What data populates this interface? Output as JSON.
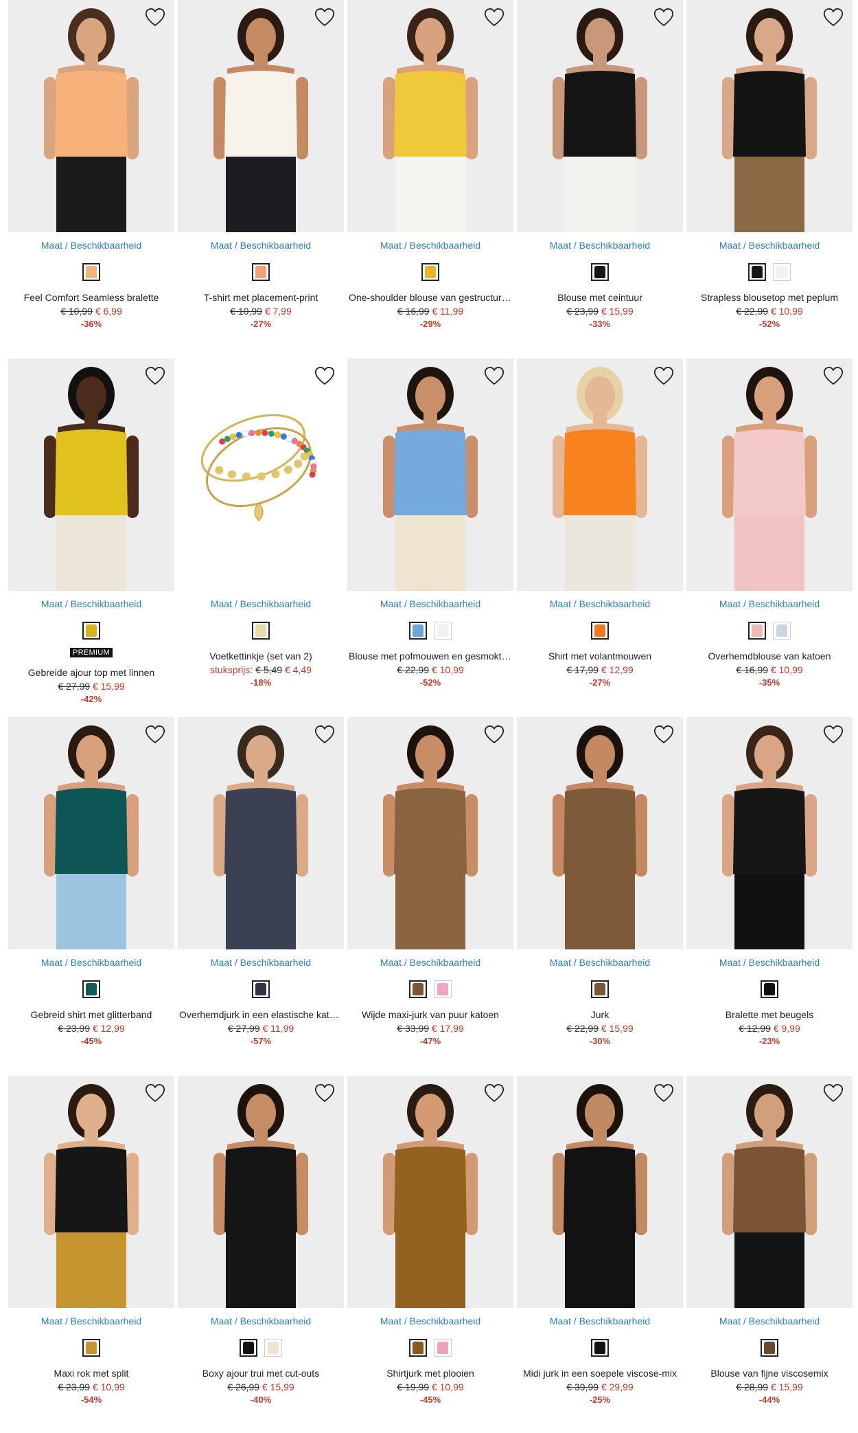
{
  "labels": {
    "maat": "Maat / Beschikbaarheid"
  },
  "colors": {
    "accent_link": "#2f7fb8",
    "sale_red": "#c0392b",
    "text": "#222222"
  },
  "products": [
    {
      "name": "Feel Comfort Seamless bralette",
      "old_price": "€ 10,99",
      "new_price": "€ 6,99",
      "discount": "-36%",
      "swatches": [
        "#f6b27a"
      ],
      "garment": "#f7b27c",
      "bottom": "#1b1b1b",
      "skin": "#d9a57f",
      "hair": "#4a2f1f",
      "bg": "#ededed"
    },
    {
      "name": "T-shirt met placement-print",
      "old_price": "€ 10,99",
      "new_price": "€ 7,99",
      "discount": "-27%",
      "swatches": [
        "#f4a07a"
      ],
      "garment": "#f7f3ea",
      "bottom": "#1c1c22",
      "skin": "#c48a63",
      "hair": "#2b1b12",
      "bg": "#ededed"
    },
    {
      "name": "One-shoulder blouse van gestructureerde stof",
      "old_price": "€ 16,99",
      "new_price": "€ 11,99",
      "discount": "-29%",
      "swatches": [
        "#e8b62a"
      ],
      "garment": "#f0c93a",
      "bottom": "#f6f4ee",
      "skin": "#d8a27f",
      "hair": "#3a2418",
      "bg": "#ededed"
    },
    {
      "name": "Blouse met ceintuur",
      "old_price": "€ 23,99",
      "new_price": "€ 15,99",
      "discount": "-33%",
      "swatches": [
        "#161616"
      ],
      "garment": "#151515",
      "bottom": "#f4f2ee",
      "skin": "#c9987a",
      "hair": "#2a1a10",
      "bg": "#ededed"
    },
    {
      "name": "Strapless blousetop met peplum",
      "old_price": "€ 22,99",
      "new_price": "€ 10,99",
      "discount": "-52%",
      "swatches": [
        "#161616",
        "#f2f2f2"
      ],
      "garment": "#141414",
      "bottom": "#8a6a44",
      "skin": "#d9a88a",
      "hair": "#2b1a10",
      "bg": "#ededed"
    },
    {
      "name": "Gebreide ajour top met linnen",
      "old_price": "€ 27,99",
      "new_price": "€ 15,99",
      "discount": "-42%",
      "premium": "PREMIUM",
      "swatches": [
        "#d9b21c"
      ],
      "garment": "#e1c21f",
      "bottom": "#ebe6d8",
      "skin": "#4a2b1c",
      "hair": "#111111",
      "bg": "#ededed"
    },
    {
      "name": "Voetkettinkje (set van 2)",
      "unit_label": "stuksprijs:",
      "old_price": "€ 5,49",
      "new_price": "€ 4,49",
      "discount": "-18%",
      "swatches": [
        "#e7d9a8"
      ],
      "jewelry": true,
      "bg": "#ffffff"
    },
    {
      "name": "Blouse met pofmouwen en gesmokt lijfje",
      "old_price": "€ 22,99",
      "new_price": "€ 10,99",
      "discount": "-52%",
      "swatches": [
        "#6aa6d9",
        "#f2f2f2"
      ],
      "garment": "#74a9dd",
      "bottom": "#efe4cf",
      "skin": "#c98f6a",
      "hair": "#1e140e",
      "bg": "#ededed"
    },
    {
      "name": "Shirt met volantmouwen",
      "old_price": "€ 17,99",
      "new_price": "€ 12,99",
      "discount": "-27%",
      "swatches": [
        "#f07a1c"
      ],
      "garment": "#f7821e",
      "bottom": "#ece7dc",
      "skin": "#e4b894",
      "hair": "#e6d2a4",
      "bg": "#ededed"
    },
    {
      "name": "Overhemdblouse van katoen",
      "old_price": "€ 16,99",
      "new_price": "€ 10,99",
      "discount": "-35%",
      "swatches": [
        "#f2b7b7",
        "#c9d6e2"
      ],
      "garment": "#f3c9c9",
      "bottom": "#f1c3c3",
      "skin": "#d8a07c",
      "hair": "#1f140d",
      "bg": "#ededed"
    },
    {
      "name": "Gebreid shirt met glitterband",
      "old_price": "€ 23,99",
      "new_price": "€ 12,99",
      "discount": "-45%",
      "swatches": [
        "#0f5a5a"
      ],
      "garment": "#0e5656",
      "bottom": "#9cc3e0",
      "skin": "#d9a07d",
      "hair": "#2a1a10",
      "bg": "#ededed"
    },
    {
      "name": "Overhemdjurk in een elastische katoenmix",
      "old_price": "€ 27,99",
      "new_price": "€ 11,99",
      "discount": "-57%",
      "swatches": [
        "#2e3445"
      ],
      "garment": "#3b4152",
      "bottom": "#3b4152",
      "skin": "#d9a988",
      "hair": "#3a2a1e",
      "bg": "#ededed"
    },
    {
      "name": "Wijde maxi-jurk van puur katoen",
      "old_price": "€ 33,99",
      "new_price": "€ 17,99",
      "discount": "-47%",
      "swatches": [
        "#7a5636",
        "#f3a3c5"
      ],
      "garment": "#8a6440",
      "bottom": "#8a6440",
      "skin": "#c88d66",
      "hair": "#1e130c",
      "bg": "#ededed"
    },
    {
      "name": "Jurk",
      "old_price": "€ 22,99",
      "new_price": "€ 15,99",
      "discount": "-30%",
      "swatches": [
        "#7a5636"
      ],
      "garment": "#7c5a3a",
      "bottom": "#7c5a3a",
      "skin": "#c48962",
      "hair": "#1c120c",
      "bg": "#ededed"
    },
    {
      "name": "Bralette met beugels",
      "old_price": "€ 12,99",
      "new_price": "€ 9,99",
      "discount": "-23%",
      "swatches": [
        "#111111"
      ],
      "garment": "#161616",
      "bottom": "#111111",
      "skin": "#d9a586",
      "hair": "#3a2416",
      "bg": "#ededed"
    },
    {
      "name": "Maxi rok met split",
      "old_price": "€ 23,99",
      "new_price": "€ 10,99",
      "discount": "-54%",
      "swatches": [
        "#c8922d"
      ],
      "garment": "#161616",
      "bottom": "#c79530",
      "skin": "#e0b08c",
      "hair": "#2a1a10",
      "bg": "#ededed"
    },
    {
      "name": "Boxy ajour trui met cut-outs",
      "old_price": "€ 26,99",
      "new_price": "€ 15,99",
      "discount": "-40%",
      "swatches": [
        "#111111",
        "#efe3d0"
      ],
      "garment": "#151515",
      "bottom": "#151515",
      "skin": "#c58c66",
      "hair": "#1d130c",
      "bg": "#ededed"
    },
    {
      "name": "Shirtjurk met plooien",
      "old_price": "€ 19,99",
      "new_price": "€ 10,99",
      "discount": "-45%",
      "swatches": [
        "#8a5a1f",
        "#f3a3b9"
      ],
      "garment": "#94621f",
      "bottom": "#94621f",
      "skin": "#d39a75",
      "hair": "#2a1a10",
      "bg": "#ededed"
    },
    {
      "name": "Midi jurk in een soepele viscose-mix",
      "old_price": "€ 39,99",
      "new_price": "€ 29,99",
      "discount": "-25%",
      "swatches": [
        "#111111"
      ],
      "garment": "#121212",
      "bottom": "#121212",
      "skin": "#c28a64",
      "hair": "#1b120b",
      "bg": "#ededed"
    },
    {
      "name": "Blouse van fijne viscosemix",
      "old_price": "€ 28,99",
      "new_price": "€ 15,99",
      "discount": "-44%",
      "swatches": [
        "#6b4a2c"
      ],
      "garment": "#7a5434",
      "bottom": "#141414",
      "skin": "#d0a07d",
      "hair": "#2c1b10",
      "bg": "#ededed"
    }
  ]
}
